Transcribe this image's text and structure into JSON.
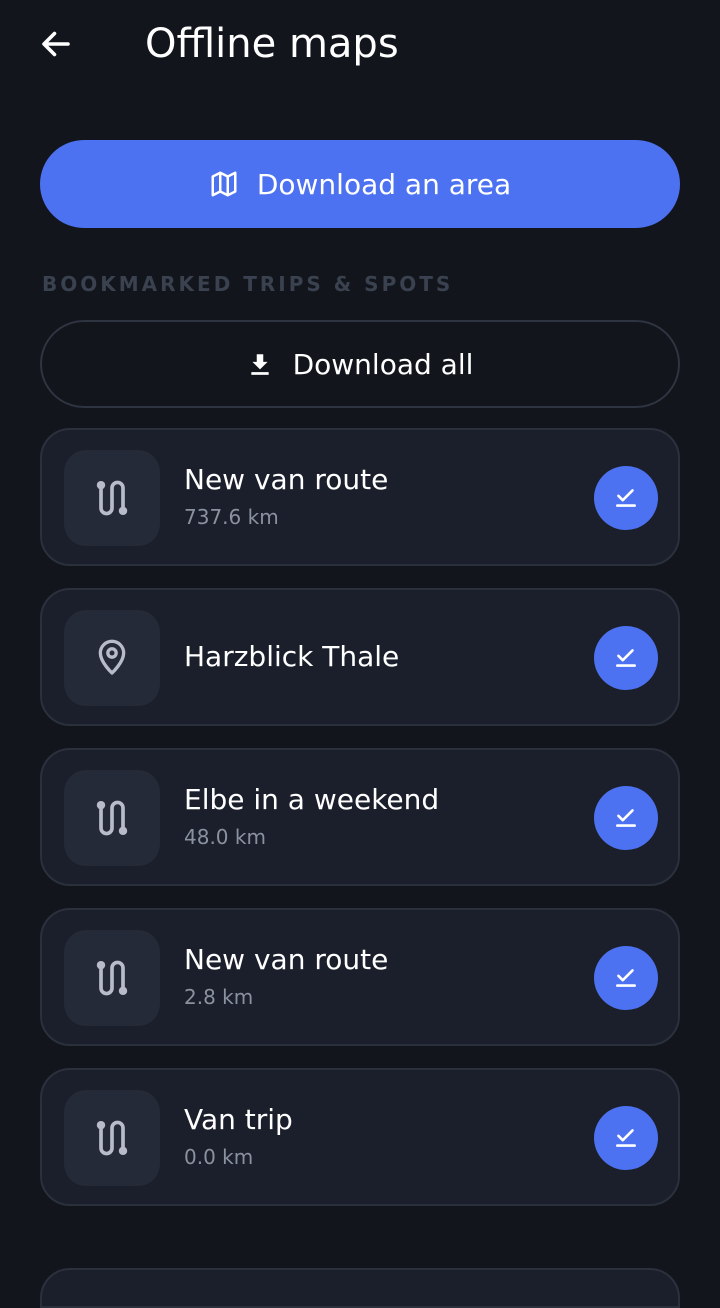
{
  "header": {
    "title": "Offline maps",
    "back_icon": "arrow-left-icon"
  },
  "download_area": {
    "label": "Download an area",
    "icon": "map-icon",
    "color": "#4d72f1"
  },
  "section": {
    "title": "BOOKMARKED TRIPS & SPOTS"
  },
  "download_all": {
    "label": "Download all",
    "icon": "download-icon"
  },
  "items": [
    {
      "title": "New van route",
      "subtitle": "737.6 km",
      "icon": "route-icon",
      "status_icon": "downloaded-check-icon"
    },
    {
      "title": "Harzblick Thale",
      "subtitle": "",
      "icon": "location-pin-icon",
      "status_icon": "downloaded-check-icon"
    },
    {
      "title": "Elbe in a weekend",
      "subtitle": "48.0 km",
      "icon": "route-icon",
      "status_icon": "downloaded-check-icon"
    },
    {
      "title": "New van route",
      "subtitle": "2.8 km",
      "icon": "route-icon",
      "status_icon": "downloaded-check-icon"
    },
    {
      "title": "Van trip",
      "subtitle": "0.0 km",
      "icon": "route-icon",
      "status_icon": "downloaded-check-icon"
    }
  ],
  "colors": {
    "background": "#12151c",
    "card": "#1b1f2b",
    "accent": "#4d72f1"
  }
}
